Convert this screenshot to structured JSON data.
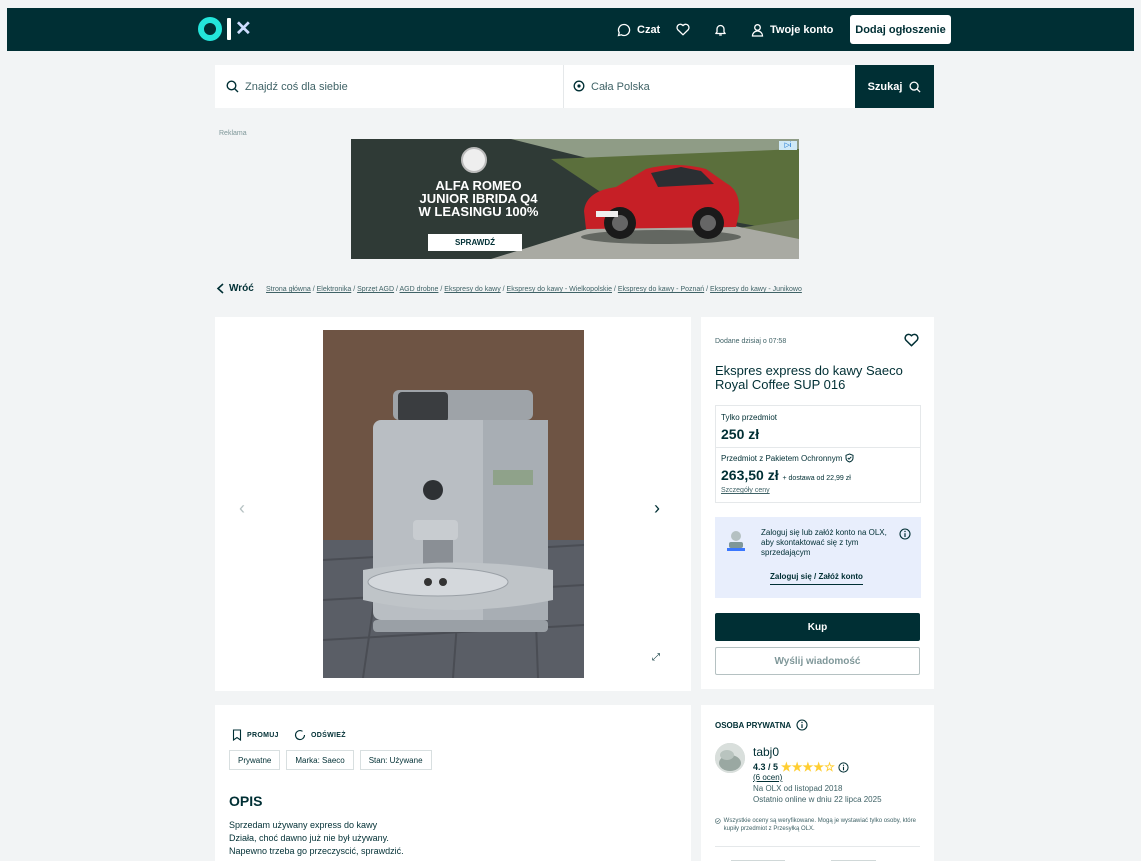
{
  "header": {
    "logo_text": "olx",
    "chat_label": "Czat",
    "account_label": "Twoje konto",
    "add_listing_label": "Dodaj ogłoszenie",
    "icons": [
      "chat-icon",
      "heart-icon",
      "bell-icon",
      "user-icon"
    ]
  },
  "search": {
    "query_placeholder": "Znajdź coś dla siebie",
    "location_placeholder": "Cała Polska",
    "submit_label": "Szukaj"
  },
  "ad": {
    "label": "Reklama",
    "headline_1": "ALFA ROMEO",
    "headline_2": "JUNIOR IBRIDA Q4",
    "headline_3": "W LEASINGU 100%",
    "cta": "SPRAWDŹ"
  },
  "breadcrumb": {
    "back_label": "Wróć",
    "items": [
      "Strona główna",
      "Elektronika",
      "Sprzęt AGD",
      "AGD drobne",
      "Ekspresy do kawy",
      "Ekspresy do kawy - Wielkopolskie",
      "Ekspresy do kawy - Poznań",
      "Ekspresy do kawy - Junikowo"
    ]
  },
  "listing": {
    "added": "Dodane dzisiaj o 07:58",
    "title": "Ekspres express do kawy Saeco Royal Coffee SUP 016",
    "price_label_item": "Tylko przedmiot",
    "price_item": "250 zł",
    "price_label_package": "Przedmiot z Pakietem Ochronnym",
    "price_package": "263,50 zł",
    "shipping": "+ dostawa od 22,99 zł",
    "price_details_link": "Szczegóły ceny",
    "login_prompt": "Zaloguj się lub załóż konto na OLX, aby skontaktować się z tym sprzedającym",
    "login_link": "Zaloguj się / Załóż konto",
    "buy_label": "Kup",
    "message_label": "Wyślij wiadomość"
  },
  "description": {
    "promote_label": "PROMUJ",
    "refresh_label": "ODŚWIEŻ",
    "tags": [
      "Prywatne",
      "Marka: Saeco",
      "Stan: Używane"
    ],
    "heading": "OPIS",
    "lines": [
      "Sprzedam używany express do kawy",
      "Działa, choć dawno już nie był używany.",
      "Napewno trzeba go przeczyscić, sprawdzić."
    ]
  },
  "seller": {
    "heading": "OSOBA PRYWATNA",
    "name": "tabj0",
    "rating": "4.3 / 5",
    "rating_value": 4.3,
    "rating_count": "(6 ocen)",
    "since": "Na OLX od listopad 2018",
    "last_online": "Ostatnio online w dniu 22 lipca 2025",
    "note": "Wszystkie oceny są weryfikowane. Mogą je wystawiać tylko osoby, które kupiły przedmiot z Przesyłką OLX."
  },
  "colors": {
    "brand_dark": "#002f34",
    "brand_teal": "#23e5db",
    "star": "#ffce32",
    "login_bg": "#e8eefc"
  }
}
